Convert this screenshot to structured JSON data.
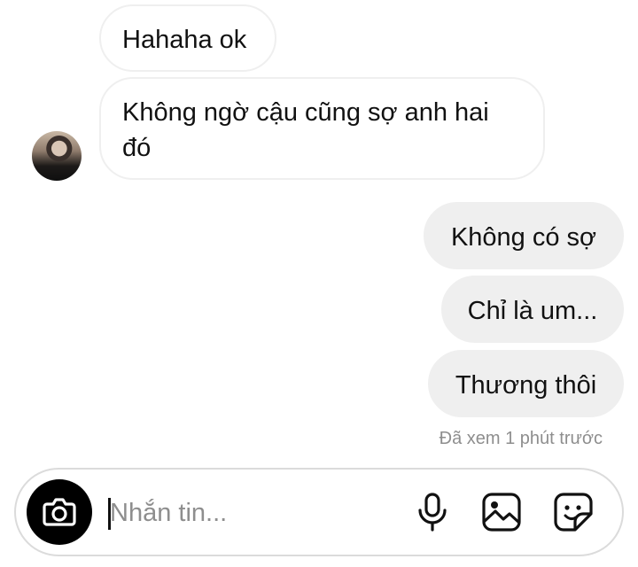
{
  "messages": [
    {
      "direction": "incoming",
      "text": "Hahaha ok"
    },
    {
      "direction": "incoming",
      "lines": [
        "Không ngờ cậu cũng sợ anh hai",
        "đó"
      ]
    },
    {
      "direction": "outgoing",
      "text": "Không có sợ"
    },
    {
      "direction": "outgoing",
      "text": "Chỉ là um..."
    },
    {
      "direction": "outgoing",
      "text": "Thương thôi"
    }
  ],
  "seen_status": "Đã xem 1 phút trước",
  "composer": {
    "placeholder": "Nhắn tin...",
    "icons": [
      "camera-icon",
      "microphone-icon",
      "image-icon",
      "sticker-icon"
    ]
  },
  "colors": {
    "outgoing_bubble": "#efefef",
    "incoming_border": "#efefef",
    "camera_button": "#000000",
    "muted_text": "#8e8e8e"
  }
}
